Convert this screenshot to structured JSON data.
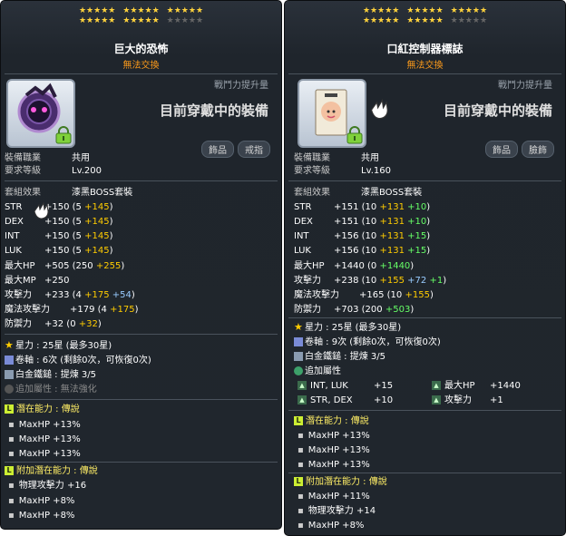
{
  "star_symbol": "★★★★★",
  "left": {
    "title": "巨大的恐怖",
    "subtitle": "無法交換",
    "power_label": "戰鬥力提升量",
    "equipped_text": "目前穿戴中的裝備",
    "tags": [
      "飾品",
      "戒指"
    ],
    "job_label": "裝備職業",
    "job_value": "共用",
    "level_label": "要求等級",
    "level_value": "Lv.200",
    "set_label": "套組效果",
    "set_value": "漆黑BOSS套裝",
    "stats": [
      {
        "name": "STR",
        "main": "+150",
        "base": "(5",
        "plus": "+145",
        ")": ")"
      },
      {
        "name": "DEX",
        "main": "+150",
        "base": "(5",
        "plus": "+145",
        ")": ")"
      },
      {
        "name": "INT",
        "main": "+150",
        "base": "(5",
        "plus": "+145",
        ")": ")"
      },
      {
        "name": "LUK",
        "main": "+150",
        "base": "(5",
        "plus": "+145",
        ")": ")"
      }
    ],
    "maxhp_label": "最大HP",
    "maxhp_main": "+505",
    "maxhp_base": "(250",
    "maxhp_plus": "+255",
    "maxhp_close": ")",
    "maxmp_label": "最大MP",
    "maxmp_main": "+250",
    "atk_label": "攻擊力",
    "atk_main": "+233",
    "atk_base": "(4",
    "atk_plus": "+175",
    "atk_plus2": "+54",
    "atk_close": ")",
    "matk_label": "魔法攻擊力",
    "matk_main": "+179",
    "matk_base": "(4",
    "matk_plus": "+175",
    "matk_close": ")",
    "def_label": "防禦力",
    "def_main": "+32",
    "def_base": "(0",
    "def_plus": "+32",
    "def_close": ")",
    "star_force": "星力 : 25星  (最多30星)",
    "scroll": "卷軸 : 6次 (剩餘0次，可恢復0次)",
    "hammer": "白金鐵鎚 : 提煉 3/5",
    "extra_label": "追加屬性 : 無法強化",
    "potential_title": "潛在能力 : 傳說",
    "potential_lines": [
      "MaxHP +13%",
      "MaxHP +13%",
      "MaxHP +13%"
    ],
    "bonus_title": "附加潛在能力 : 傳說",
    "bonus_lines": [
      "物理攻擊力 +16",
      "MaxHP +8%",
      "MaxHP +8%"
    ]
  },
  "right": {
    "title": "口紅控制器標誌",
    "subtitle": "無法交換",
    "power_label": "戰鬥力提升量",
    "equipped_text": "目前穿戴中的裝備",
    "tags": [
      "飾品",
      "臉飾"
    ],
    "job_label": "裝備職業",
    "job_value": "共用",
    "level_label": "要求等級",
    "level_value": "Lv.160",
    "set_label": "套組效果",
    "set_value": "漆黑BOSS套裝",
    "stats": [
      {
        "name": "STR",
        "main": "+151",
        "base": "(10",
        "plus": "+131",
        "plus2": "+10"
      },
      {
        "name": "DEX",
        "main": "+151",
        "base": "(10",
        "plus": "+131",
        "plus2": "+10"
      },
      {
        "name": "INT",
        "main": "+156",
        "base": "(10",
        "plus": "+131",
        "plus2": "+15"
      },
      {
        "name": "LUK",
        "main": "+156",
        "base": "(10",
        "plus": "+131",
        "plus2": "+15"
      }
    ],
    "maxhp_label": "最大HP",
    "maxhp_main": "+1440",
    "maxhp_base": "(0",
    "maxhp_plus": "+1440",
    "maxhp_close": ")",
    "atk_label": "攻擊力",
    "atk_main": "+238",
    "atk_base": "(10",
    "atk_plus": "+155",
    "atk_plus2": "+72",
    "atk_plus3": "+1",
    "atk_close": ")",
    "matk_label": "魔法攻擊力",
    "matk_main": "+165",
    "matk_base": "(10",
    "matk_plus": "+155",
    "matk_close": ")",
    "def_label": "防禦力",
    "def_main": "+703",
    "def_base": "(200",
    "def_plus": "+503",
    "def_close": ")",
    "star_force": "星力 : 25星  (最多30星)",
    "scroll": "卷軸 : 9次 (剩餘0次，可恢復0次)",
    "hammer": "白金鐵鎚 : 提煉 3/5",
    "extra_label": "追加屬性",
    "extra_items": [
      {
        "label": "INT, LUK",
        "value": "+15"
      },
      {
        "label": "最大HP",
        "value": "+1440"
      },
      {
        "label": "STR, DEX",
        "value": "+10"
      },
      {
        "label": "攻擊力",
        "value": "+1"
      }
    ],
    "potential_title": "潛在能力 : 傳說",
    "potential_lines": [
      "MaxHP +13%",
      "MaxHP +13%",
      "MaxHP +13%"
    ],
    "bonus_title": "附加潛在能力 : 傳說",
    "bonus_lines": [
      "MaxHP +11%",
      "物理攻擊力 +14",
      "MaxHP +8%"
    ]
  }
}
